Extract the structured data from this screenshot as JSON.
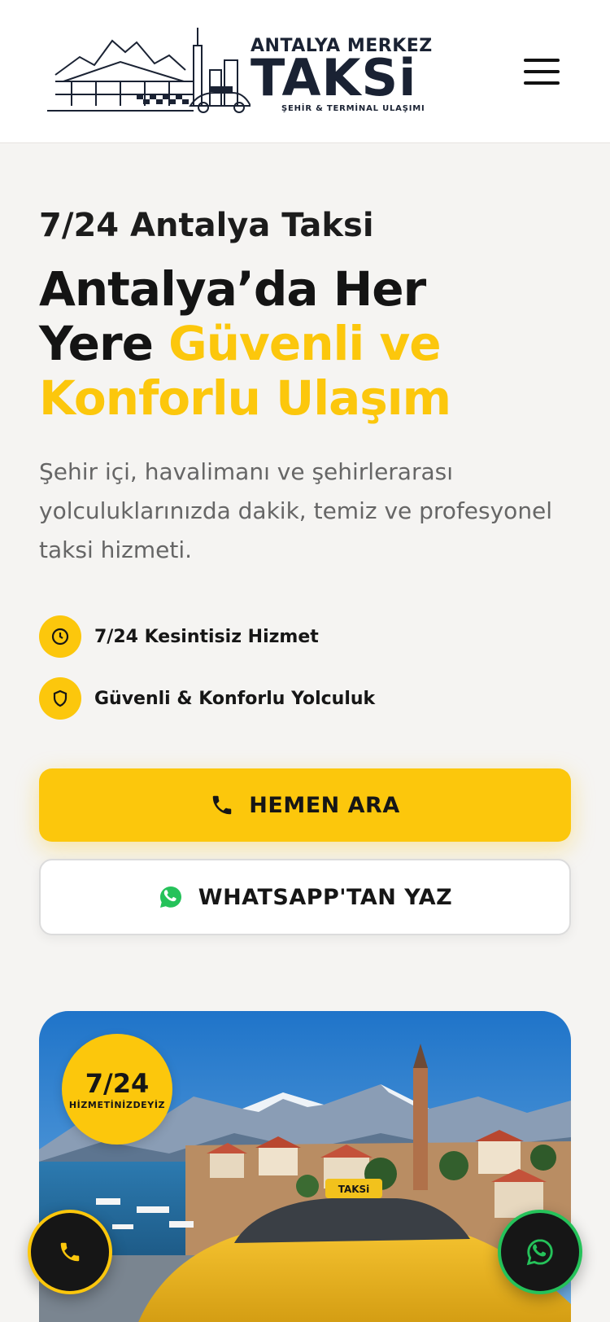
{
  "header": {
    "logo": {
      "line1": "ANTALYA MERKEZ",
      "line2": "TAKSi",
      "tagline": "ŞEHİR & TERMİNAL ULAŞIMI"
    },
    "menu_icon": "hamburger-menu-icon"
  },
  "hero": {
    "eyebrow": "7/24 Antalya Taksi",
    "title_part1": "Antalya’da Her Yere ",
    "title_highlight": "Güvenli ve Konforlu Ulaşım",
    "description": "Şehir içi, havalimanı ve şehirlerarası yolculuklarınızda dakik, temiz ve profesyonel taksi hizmeti.",
    "features": [
      {
        "icon": "clock-icon",
        "label": "7/24 Kesintisiz Hizmet"
      },
      {
        "icon": "shield-icon",
        "label": "Güvenli & Konforlu Yolculuk"
      }
    ],
    "call_button": "HEMEN ARA",
    "whatsapp_button": "WHATSAPP'TAN YAZ"
  },
  "photo_badge": {
    "big": "7/24",
    "small": "HİZMETİNİZDEYİZ"
  },
  "floating": {
    "call_icon": "phone-icon",
    "whatsapp_icon": "whatsapp-icon"
  },
  "colors": {
    "accent": "#fcc70c",
    "dark": "#161616",
    "whatsapp": "#25c25a",
    "text_muted": "#666666",
    "background": "#f5f4f2"
  }
}
